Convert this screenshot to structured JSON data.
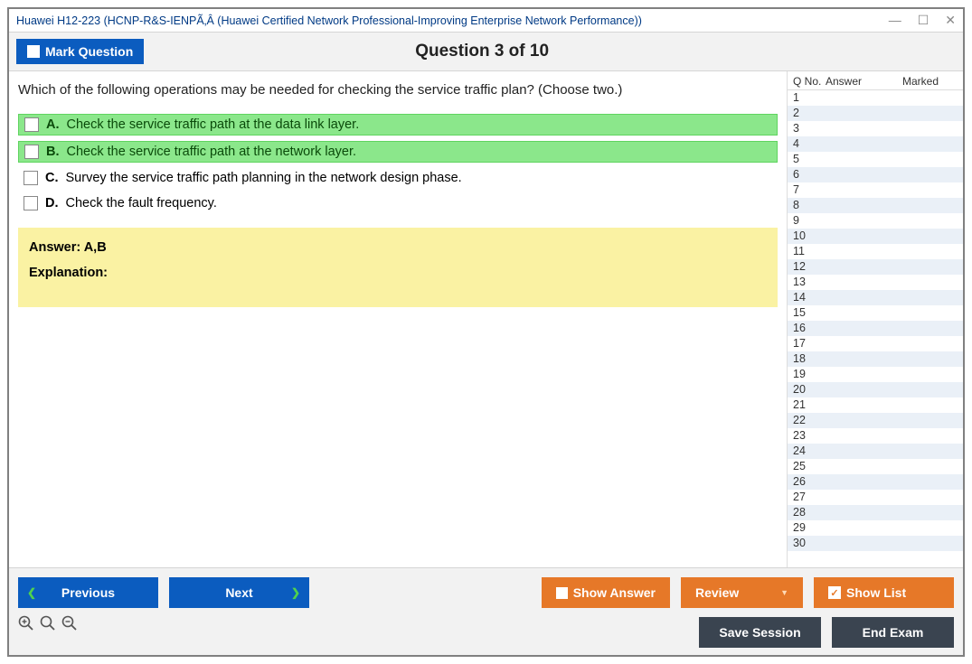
{
  "window_title": "Huawei H12-223 (HCNP-R&S-IENPÃ‚Â (Huawei Certified Network Professional-Improving Enterprise Network Performance))",
  "topbar": {
    "mark_label": "Mark Question",
    "question_header": "Question 3 of 10"
  },
  "question": {
    "text": "Which of the following operations may be needed for checking the service traffic plan? (Choose two.)",
    "options": [
      {
        "letter": "A.",
        "text": "Check the service traffic path at the data link layer.",
        "correct": true
      },
      {
        "letter": "B.",
        "text": "Check the service traffic path at the network layer.",
        "correct": true
      },
      {
        "letter": "C.",
        "text": "Survey the service traffic path planning in the network design phase.",
        "correct": false
      },
      {
        "letter": "D.",
        "text": "Check the fault frequency.",
        "correct": false
      }
    ],
    "answer": "Answer: A,B",
    "explanation_label": "Explanation:"
  },
  "side": {
    "h_qno": "Q No.",
    "h_answer": "Answer",
    "h_marked": "Marked",
    "rows": [
      "1",
      "2",
      "3",
      "4",
      "5",
      "6",
      "7",
      "8",
      "9",
      "10",
      "11",
      "12",
      "13",
      "14",
      "15",
      "16",
      "17",
      "18",
      "19",
      "20",
      "21",
      "22",
      "23",
      "24",
      "25",
      "26",
      "27",
      "28",
      "29",
      "30"
    ]
  },
  "buttons": {
    "previous": "Previous",
    "next": "Next",
    "show_answer": "Show Answer",
    "review": "Review",
    "show_list": "Show List",
    "save_session": "Save Session",
    "end_exam": "End Exam"
  }
}
